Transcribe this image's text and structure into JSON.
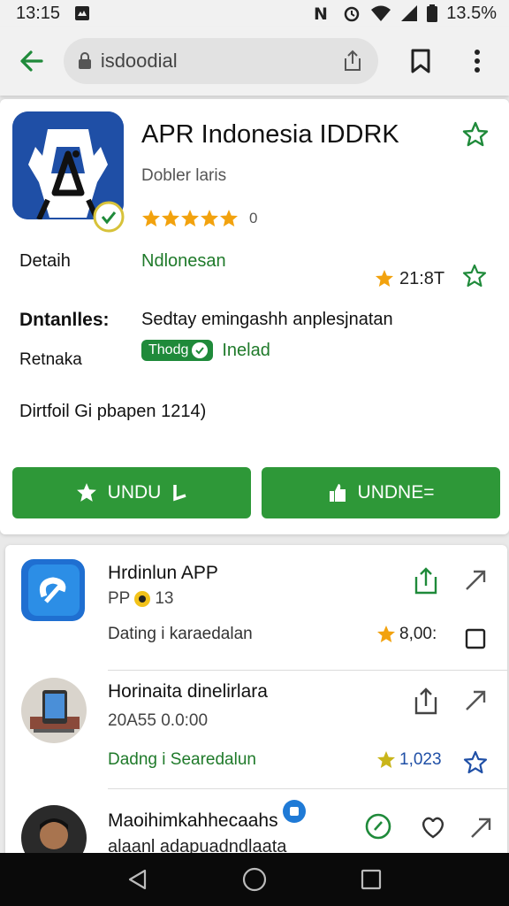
{
  "status_bar": {
    "time": "13:15",
    "battery": "13.5%"
  },
  "browser": {
    "url": "isdoodial"
  },
  "app": {
    "title": "APR Indonesia IDDRK",
    "developer": "Dobler laris",
    "rating_count": "0",
    "stars": 5,
    "detail_label": "Detaih",
    "detail_value": "Ndlonesan",
    "score": "21:8T",
    "desc_label": "Dntanlles:",
    "desc_value": "Sedtay emingashh anplesjnatan",
    "retnaka_label": "Retnaka",
    "chip_badge": "Thodg",
    "chip_label": "Inelad",
    "footer_text": "Dirtfoil Gi pbapen 1214)",
    "button_1": "UNDU",
    "button_2": "UNDNE="
  },
  "list": {
    "items": [
      {
        "title": "Hrdinlun APP",
        "sub_prefix": "PP",
        "sub_suffix": "13",
        "meta": "Dating i karaedalan",
        "score": "8,00:"
      },
      {
        "title": "Horinaita dinelirlara",
        "sub": "20A55 0.0:00",
        "meta": "Dadng i Searedalun",
        "score": "1,023"
      },
      {
        "title": "Maoihimkahhecaahs",
        "sub": "alaanl adapuadndlaata"
      }
    ]
  },
  "colors": {
    "accent_green": "#2e9838",
    "text_green": "#1f7a2a",
    "app_blue": "#1f4fa6",
    "star": "#f2a20e"
  }
}
